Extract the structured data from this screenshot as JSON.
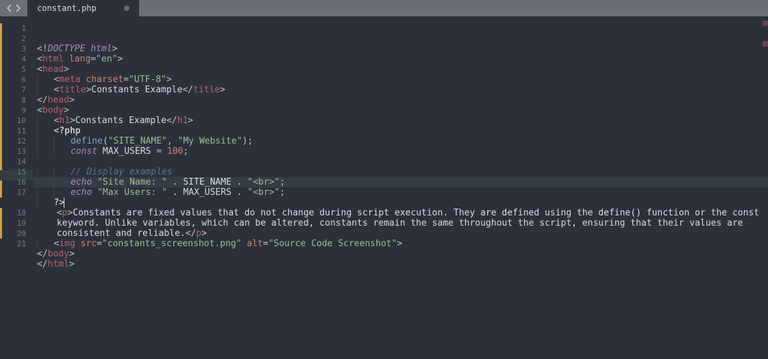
{
  "tab": {
    "title": "constant.php",
    "modified": true
  },
  "gutter": {
    "lines": [
      "1",
      "2",
      "3",
      "4",
      "5",
      "6",
      "7",
      "8",
      "9",
      "10",
      "11",
      "12",
      "13",
      "14",
      "15",
      "16",
      "17",
      "",
      "18",
      "19",
      "20",
      "21"
    ],
    "highlight_index": 15,
    "mod_spans": [
      [
        0,
        17
      ],
      [
        18,
        3
      ]
    ]
  },
  "code": {
    "highlight_index": 15,
    "lines": [
      {
        "t": "html",
        "i": 0,
        "parts": [
          [
            "punc",
            "<!"
          ],
          [
            "doc",
            "DOCTYPE html"
          ],
          [
            "punc",
            ">"
          ]
        ]
      },
      {
        "t": "html",
        "i": 0,
        "parts": [
          [
            "punc",
            "<"
          ],
          [
            "tag",
            "html"
          ],
          [
            "plain",
            " "
          ],
          [
            "attr",
            "lang"
          ],
          [
            "punc",
            "="
          ],
          [
            "str",
            "\"en\""
          ],
          [
            "punc",
            ">"
          ]
        ]
      },
      {
        "t": "html",
        "i": 0,
        "parts": [
          [
            "punc",
            "<"
          ],
          [
            "tag",
            "head"
          ],
          [
            "punc",
            ">"
          ]
        ]
      },
      {
        "t": "html",
        "i": 1,
        "parts": [
          [
            "punc",
            "<"
          ],
          [
            "tag",
            "meta"
          ],
          [
            "plain",
            " "
          ],
          [
            "attr",
            "charset"
          ],
          [
            "punc",
            "="
          ],
          [
            "str",
            "\"UTF-8\""
          ],
          [
            "punc",
            ">"
          ]
        ]
      },
      {
        "t": "html",
        "i": 1,
        "parts": [
          [
            "punc",
            "<"
          ],
          [
            "tag",
            "title"
          ],
          [
            "punc",
            ">"
          ],
          [
            "plain",
            "Constants Example"
          ],
          [
            "punc",
            "</"
          ],
          [
            "tag",
            "title"
          ],
          [
            "punc",
            ">"
          ]
        ]
      },
      {
        "t": "html",
        "i": 0,
        "parts": [
          [
            "punc",
            "</"
          ],
          [
            "tag",
            "head"
          ],
          [
            "punc",
            ">"
          ]
        ]
      },
      {
        "t": "html",
        "i": 0,
        "parts": [
          [
            "punc",
            "<"
          ],
          [
            "tag",
            "body"
          ],
          [
            "punc",
            ">"
          ]
        ]
      },
      {
        "t": "html",
        "i": 1,
        "parts": [
          [
            "punc",
            "<"
          ],
          [
            "tag",
            "h1"
          ],
          [
            "punc",
            ">"
          ],
          [
            "plain",
            "Constants Example"
          ],
          [
            "punc",
            "</"
          ],
          [
            "tag",
            "h1"
          ],
          [
            "punc",
            ">"
          ]
        ]
      },
      {
        "t": "php",
        "i": 1,
        "parts": [
          [
            "phpopen",
            "<?php"
          ]
        ]
      },
      {
        "t": "php",
        "i": 2,
        "parts": [
          [
            "fn",
            "define"
          ],
          [
            "punc",
            "("
          ],
          [
            "str",
            "\"SITE_NAME\""
          ],
          [
            "punc",
            ", "
          ],
          [
            "str",
            "\"My Website\""
          ],
          [
            "punc",
            ");"
          ]
        ]
      },
      {
        "t": "php",
        "i": 2,
        "parts": [
          [
            "kw",
            "const"
          ],
          [
            "plain",
            " MAX_USERS "
          ],
          [
            "punc",
            "= "
          ],
          [
            "num",
            "100"
          ],
          [
            "punc",
            ";"
          ]
        ]
      },
      {
        "t": "php",
        "i": 0,
        "parts": []
      },
      {
        "t": "php",
        "i": 2,
        "parts": [
          [
            "com",
            "// Display examples"
          ]
        ]
      },
      {
        "t": "php",
        "i": 2,
        "parts": [
          [
            "kw",
            "echo"
          ],
          [
            "plain",
            " "
          ],
          [
            "str",
            "\"Site Name: \""
          ],
          [
            "plain",
            " . SITE_NAME . "
          ],
          [
            "str",
            "\"<br>\""
          ],
          [
            "punc",
            ";"
          ]
        ]
      },
      {
        "t": "php",
        "i": 2,
        "parts": [
          [
            "kw",
            "echo"
          ],
          [
            "plain",
            " "
          ],
          [
            "str",
            "\"Max Users: \""
          ],
          [
            "plain",
            " . MAX_USERS . "
          ],
          [
            "str",
            "\"<br>\""
          ],
          [
            "punc",
            ";"
          ]
        ]
      },
      {
        "t": "php",
        "i": 1,
        "cursor": true,
        "parts": [
          [
            "phpopen",
            "?>"
          ]
        ]
      },
      {
        "t": "html",
        "i": 1,
        "wrap": true,
        "parts": [
          [
            "punc",
            "<"
          ],
          [
            "tag",
            "p"
          ],
          [
            "punc",
            ">"
          ],
          [
            "plain",
            "Constants are fixed values that do not change during script execution. They are defined using the define() function or the const keyword. Unlike variables, which can be altered, constants remain the same throughout the script, ensuring that their values are consistent and reliable."
          ],
          [
            "punc",
            "</"
          ],
          [
            "tag",
            "p"
          ],
          [
            "punc",
            ">"
          ]
        ]
      },
      {
        "t": "html",
        "i": 1,
        "parts": [
          [
            "punc",
            "<"
          ],
          [
            "tag",
            "img"
          ],
          [
            "plain",
            " "
          ],
          [
            "attr",
            "src"
          ],
          [
            "punc",
            "="
          ],
          [
            "str",
            "\"constants_screenshot.png\""
          ],
          [
            "plain",
            " "
          ],
          [
            "attr",
            "alt"
          ],
          [
            "punc",
            "="
          ],
          [
            "str",
            "\"Source Code Screenshot\""
          ],
          [
            "punc",
            ">"
          ]
        ]
      },
      {
        "t": "html",
        "i": 0,
        "parts": [
          [
            "punc",
            "</"
          ],
          [
            "tag",
            "body"
          ],
          [
            "punc",
            ">"
          ]
        ]
      },
      {
        "t": "html",
        "i": 0,
        "parts": [
          [
            "punc",
            "</"
          ],
          [
            "tag",
            "html"
          ],
          [
            "punc",
            ">"
          ]
        ]
      },
      {
        "t": "html",
        "i": 0,
        "parts": []
      }
    ]
  }
}
